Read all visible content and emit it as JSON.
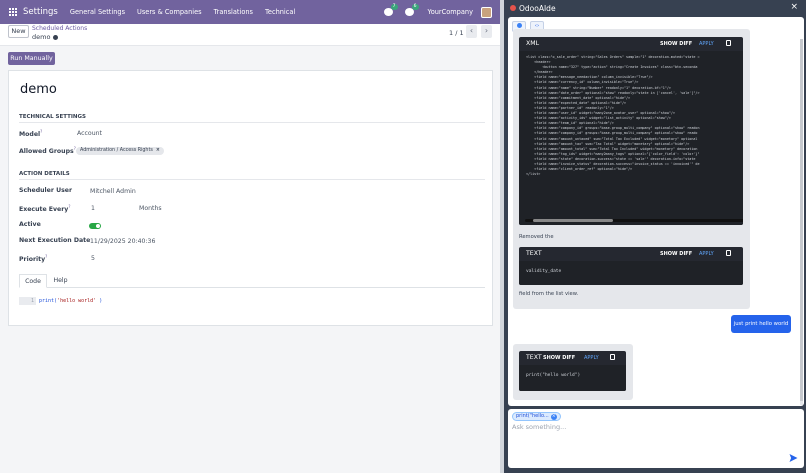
{
  "topbar": {
    "app_name": "Settings",
    "menu": [
      "General Settings",
      "Users & Companies",
      "Translations",
      "Technical"
    ],
    "chat_badge": "7",
    "activity_badge": "6",
    "company": "YourCompany"
  },
  "control": {
    "new_label": "New",
    "breadcrumb_parent": "Scheduled Actions",
    "breadcrumb_current": "demo",
    "pager": "1 / 1"
  },
  "run_manually_label": "Run Manually",
  "record": {
    "name": "demo",
    "technical_settings_title": "TECHNICAL SETTINGS",
    "model_label": "Model",
    "model_value": "Account",
    "groups_label": "Allowed Groups",
    "groups_tag": "Administration / Access Rights",
    "action_details_title": "ACTION DETAILS",
    "user_label": "Scheduler User",
    "user_value": "Mitchell Admin",
    "every_label": "Execute Every",
    "every_value": "1",
    "every_unit": "Months",
    "active_label": "Active",
    "active_value": true,
    "next_exec_label": "Next Execution Date",
    "next_exec_value": "11/29/2025 20:40:36",
    "priority_label": "Priority",
    "priority_value": "5",
    "tabs": [
      "Code",
      "Help"
    ],
    "code": {
      "line_no": "1",
      "fn": "print(",
      "arg": "'hello world'",
      "close": ")"
    }
  },
  "panel": {
    "title": "OdooAIde",
    "close": "×",
    "xml_card": {
      "lang": "XML",
      "show_diff": "SHOW DIFF",
      "apply": "APPLY",
      "lines": [
        "<list class=\"o_sale_order\" string=\"Sales Orders\" sample=\"1\" decoration-muted=\"state =",
        "    <header>",
        "        <button name=\"327\" type=\"action\" string=\"Create Invoices\" class=\"btn-seconda",
        "    </header>",
        "    <field name=\"message_needaction\" column_invisible=\"True\"/>",
        "    <field name=\"currency_id\" column_invisible=\"True\"/>",
        "    <field name=\"name\" string=\"Number\" readonly=\"1\" decoration-bf=\"1\"/>",
        "    <field name=\"date_order\" optional=\"show\" readonly=\"state in ['cancel', 'sale']\"/>",
        "    <field name=\"commitment_date\" optional=\"hide\"/>",
        "    <field name=\"expected_date\" optional=\"hide\"/>",
        "    <field name=\"partner_id\" readonly=\"1\"/>",
        "    <field name=\"user_id\" widget=\"many2one_avatar_user\" optional=\"show\"/>",
        "    <field name=\"activity_ids\" widget=\"list_activity\" optional=\"show\"/>",
        "    <field name=\"team_id\" optional=\"hide\"/>",
        "    <field name=\"company_id\" groups=\"base.group_multi_company\" optional=\"show\" readon",
        "    <field name=\"company_id\" groups=\"base.group_multi_company\" optional=\"show\" reado",
        "    <field name=\"amount_untaxed\" sum=\"Total Tax Excluded\" widget=\"monetary\" optional",
        "    <field name=\"amount_tax\" sum=\"Tax Total\" widget=\"monetary\" optional=\"hide\"/>",
        "    <field name=\"amount_total\" sum=\"Total Tax Included\" widget=\"monetary\" decoration",
        "    <field name=\"tag_ids\" widget=\"many2many_tags\" optional=\"{'color_field': 'color'}\"",
        "    <field name=\"state\" decoration-success=\"state == 'sale'\" decoration-info=\"state",
        "    <field name=\"invoice_status\" decoration-success=\"invoice_status == 'invoiced'\" de",
        "    <field name=\"client_order_ref\" optional=\"hide\"/>",
        "</list>"
      ]
    },
    "removed_text": "Removed the",
    "text_card1": {
      "lang": "TEXT",
      "show_diff": "SHOW DIFF",
      "apply": "APPLY",
      "code": "validity_date"
    },
    "removed_after": "field from the list view.",
    "user_message": "just print hello world",
    "text_card2": {
      "lang": "TEXT",
      "show_diff": "SHOW DIFF",
      "apply": "APPLY",
      "code": "print(\"hello world\")"
    },
    "chip_label": "print(\"hello...",
    "input_placeholder": "Ask something..."
  }
}
